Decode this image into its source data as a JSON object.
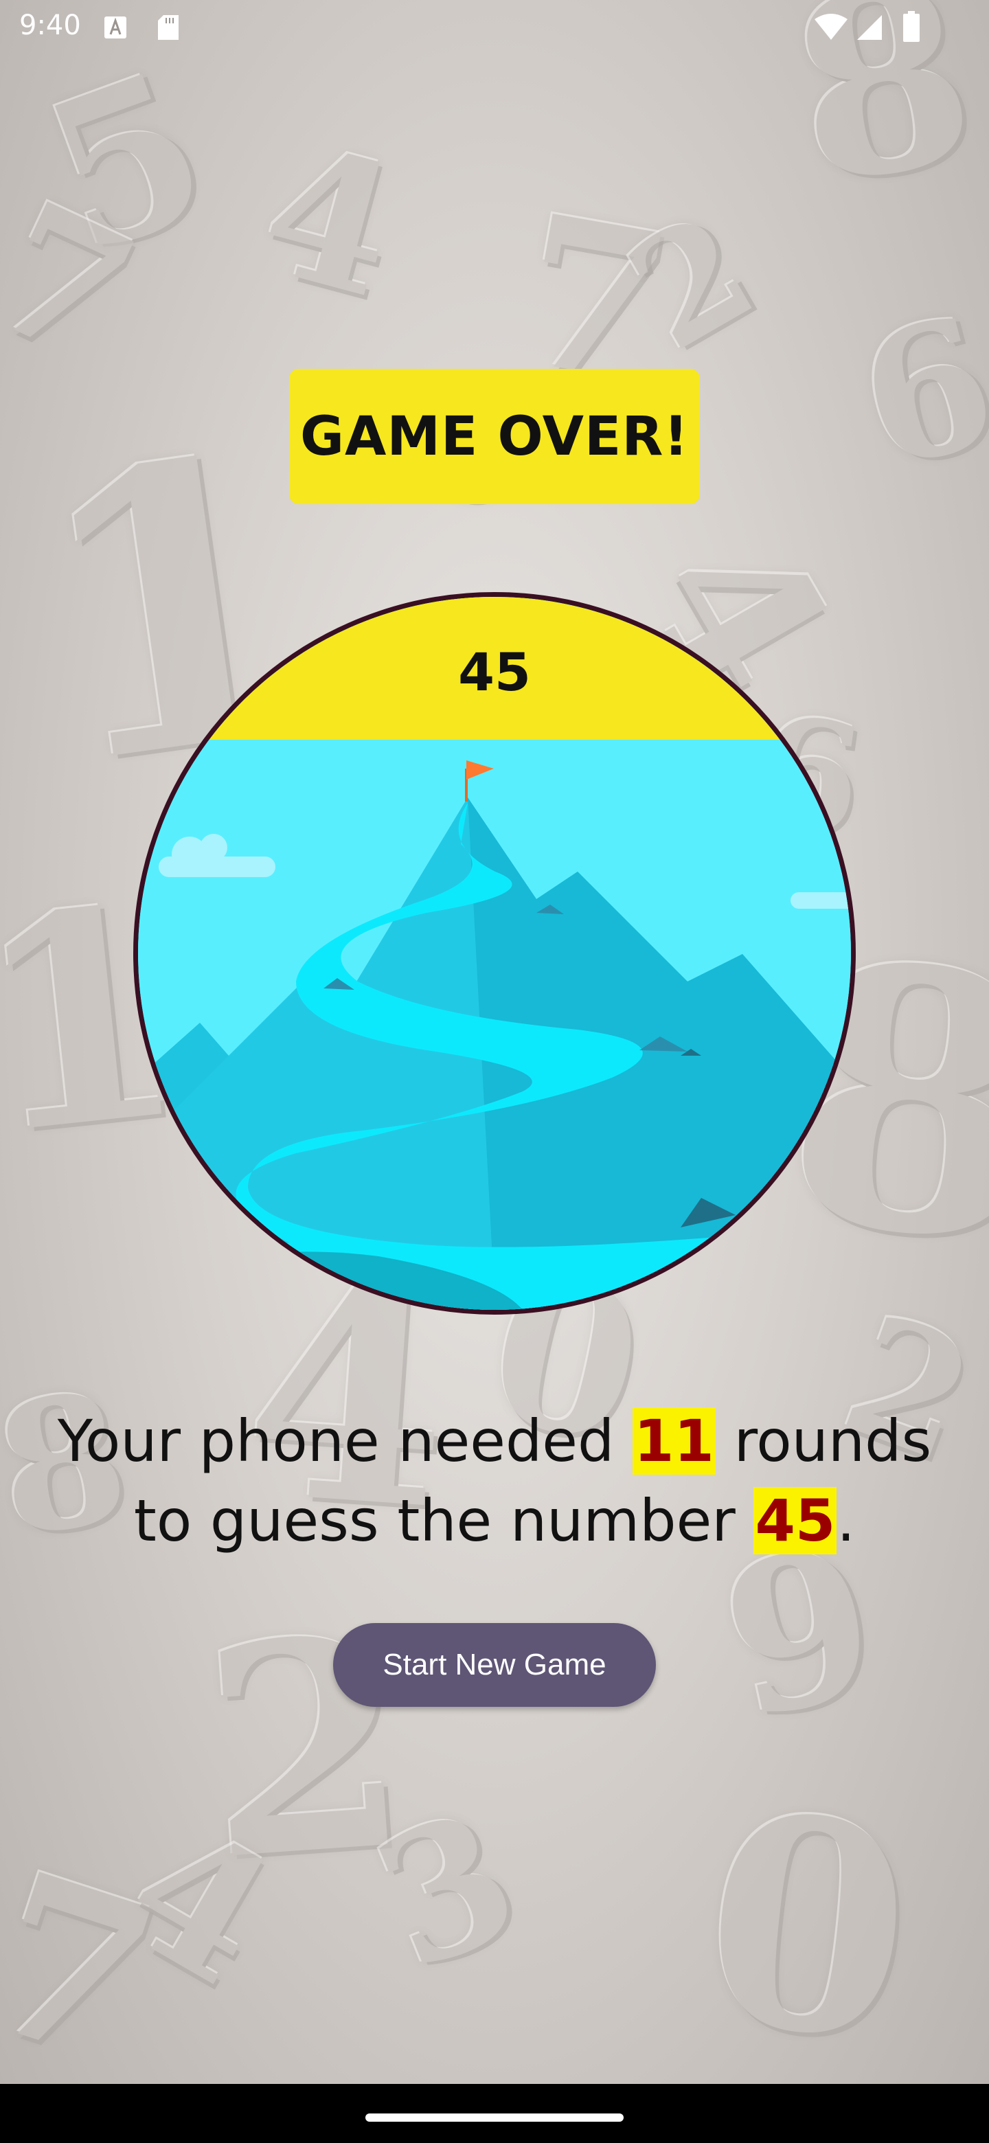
{
  "status_bar": {
    "time": "9:40",
    "icons": [
      "font-icon",
      "sd-card-icon",
      "wifi-icon",
      "cell-signal-icon",
      "battery-icon"
    ]
  },
  "background": {
    "digits": [
      "5",
      "4",
      "8",
      "7",
      "1",
      "7",
      "4",
      "2",
      "8",
      "1",
      "4",
      "6",
      "0",
      "2",
      "7",
      "9",
      "6",
      "3",
      "0",
      "4",
      "8",
      "2",
      "0"
    ]
  },
  "game_over": {
    "title": "GAME OVER!",
    "number": "45",
    "illustration": "mountain-summit-flag",
    "summary": {
      "prefix": "Your phone needed ",
      "rounds": "11",
      "middle": " rounds to guess the number ",
      "target": "45",
      "suffix": "."
    },
    "button_label": "Start New Game"
  },
  "colors": {
    "title_bg": "#f6e71f",
    "highlight_bg": "#fbf200",
    "highlight_text": "#9b0000",
    "button_bg": "#5f5676",
    "circle_border": "#3a0f22",
    "sky": "#59eefe"
  }
}
